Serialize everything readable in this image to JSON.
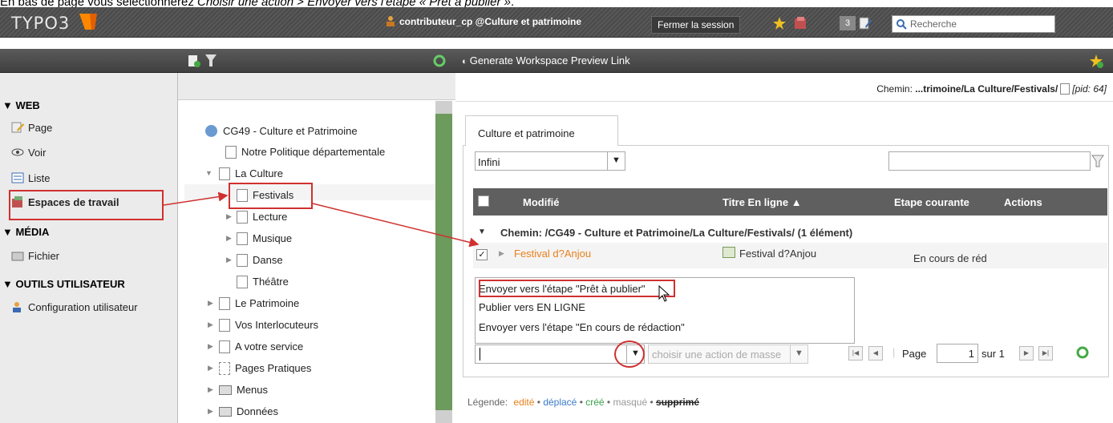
{
  "caption": {
    "prefix": "En bas de page vous sélectionnerez ",
    "italic": "Choisir une action",
    "middle": " > ",
    "italic2": "Envoyer vers l'étape « Prêt à publier »",
    "suffix": "."
  },
  "topbar": {
    "logo": "TYPO3",
    "user": "contributeur_cp @Culture et patrimoine",
    "logout": "Fermer la session",
    "badge": "3",
    "search_placeholder": "Recherche"
  },
  "toolbar": {
    "preview_link": "Generate Workspace Preview Link"
  },
  "modules": {
    "web": "▼ WEB",
    "page": "Page",
    "voir": "Voir",
    "liste": "Liste",
    "workspaces": "Espaces de travail",
    "media": "▼ MÉDIA",
    "fichier": "Fichier",
    "outils": "▼ OUTILS UTILISATEUR",
    "config": "Configuration utilisateur"
  },
  "tree": {
    "root": "CG49 - Culture et Patrimoine",
    "items": [
      "Notre Politique départementale",
      "La Culture",
      "Festivals",
      "Lecture",
      "Musique",
      "Danse",
      "Théâtre",
      "Le Patrimoine",
      "Vos Interlocuteurs",
      "A votre service",
      "Pages Pratiques",
      "Menus",
      "Données"
    ]
  },
  "right": {
    "path_label": "Chemin: ",
    "path_value": "...trimoine/La Culture/Festivals/",
    "pid": "[pid: 64]",
    "tab": "Culture et patrimoine",
    "depth_select": "Infini",
    "columns": {
      "modified": "Modifié",
      "title": "Titre En ligne ▲",
      "stage": "Etape courante",
      "actions": "Actions"
    },
    "group": "Chemin: /CG49 - Culture et Patrimoine/La Culture/Festivals/ (1 élément)",
    "row": {
      "modified": "Festival d?Anjou",
      "title": "Festival d?Anjou",
      "stage": "En cours de réd"
    },
    "menu": [
      "Envoyer vers l'étape \"Prêt à publier\"",
      "Publier vers EN LIGNE",
      "Envoyer vers l'étape \"En cours de rédaction\""
    ],
    "mass_action": "choisir une action de masse",
    "pager": {
      "page_label": "Page",
      "page_value": "1",
      "of": "sur 1"
    },
    "legend": {
      "label": "Légende:",
      "edited": "edité",
      "moved": "déplacé",
      "created": "créé",
      "hidden": "masqué",
      "deleted": "supprimé"
    }
  },
  "colors": {
    "highlight": "#d03030",
    "edited": "#e8811c",
    "moved": "#3a7bc8",
    "created": "#3aa04a"
  }
}
